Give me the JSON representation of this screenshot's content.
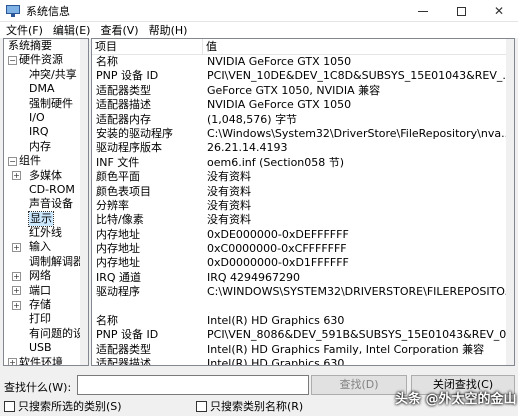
{
  "window": {
    "title": "系统信息"
  },
  "menu": {
    "file": "文件(F)",
    "edit": "编辑(E)",
    "view": "查看(V)",
    "help": "帮助(H)"
  },
  "tree": [
    {
      "label": "系统摘要",
      "indent": 0,
      "exp": ""
    },
    {
      "label": "硬件资源",
      "indent": 1,
      "exp": "−"
    },
    {
      "label": "冲突/共享",
      "indent": 2,
      "exp": ""
    },
    {
      "label": "DMA",
      "indent": 2,
      "exp": ""
    },
    {
      "label": "强制硬件",
      "indent": 2,
      "exp": ""
    },
    {
      "label": "I/O",
      "indent": 2,
      "exp": ""
    },
    {
      "label": "IRQ",
      "indent": 2,
      "exp": ""
    },
    {
      "label": "内存",
      "indent": 2,
      "exp": ""
    },
    {
      "label": "组件",
      "indent": 1,
      "exp": "−"
    },
    {
      "label": "多媒体",
      "indent": 2,
      "exp": "+"
    },
    {
      "label": "CD-ROM",
      "indent": 2,
      "exp": ""
    },
    {
      "label": "声音设备",
      "indent": 2,
      "exp": ""
    },
    {
      "label": "显示",
      "indent": 2,
      "exp": "",
      "selected": true
    },
    {
      "label": "红外线",
      "indent": 2,
      "exp": ""
    },
    {
      "label": "输入",
      "indent": 2,
      "exp": "+"
    },
    {
      "label": "调制解调器",
      "indent": 2,
      "exp": ""
    },
    {
      "label": "网络",
      "indent": 2,
      "exp": "+"
    },
    {
      "label": "端口",
      "indent": 2,
      "exp": "+"
    },
    {
      "label": "存储",
      "indent": 2,
      "exp": "+"
    },
    {
      "label": "打印",
      "indent": 2,
      "exp": ""
    },
    {
      "label": "有问题的设",
      "indent": 2,
      "exp": ""
    },
    {
      "label": "USB",
      "indent": 2,
      "exp": ""
    },
    {
      "label": "软件环境",
      "indent": 1,
      "exp": "+"
    }
  ],
  "table": {
    "col_item": "项目",
    "col_value": "值",
    "rows": [
      {
        "item": "名称",
        "value": "NVIDIA GeForce GTX 1050"
      },
      {
        "item": "PNP 设备 ID",
        "value": "PCI\\VEN_10DE&DEV_1C8D&SUBSYS_15E01043&REV_..."
      },
      {
        "item": "适配器类型",
        "value": "GeForce GTX 1050, NVIDIA 兼容"
      },
      {
        "item": "适配器描述",
        "value": "NVIDIA GeForce GTX 1050"
      },
      {
        "item": "适配器内存",
        "value": "(1,048,576) 字节"
      },
      {
        "item": "安装的驱动程序",
        "value": "C:\\Windows\\System32\\DriverStore\\FileRepository\\nva..."
      },
      {
        "item": "驱动程序版本",
        "value": "26.21.14.4193"
      },
      {
        "item": "INF 文件",
        "value": "oem6.inf (Section058 节)"
      },
      {
        "item": "颜色平面",
        "value": "没有资料"
      },
      {
        "item": "颜色表项目",
        "value": "没有资料"
      },
      {
        "item": "分辨率",
        "value": "没有资料"
      },
      {
        "item": "比特/像素",
        "value": "没有资料"
      },
      {
        "item": "内存地址",
        "value": "0xDE000000-0xDEFFFFFF"
      },
      {
        "item": "内存地址",
        "value": "0xC0000000-0xCFFFFFFF"
      },
      {
        "item": "内存地址",
        "value": "0xD0000000-0xD1FFFFFF"
      },
      {
        "item": "IRQ 通道",
        "value": "IRQ 4294967290"
      },
      {
        "item": "驱动程序",
        "value": "C:\\WINDOWS\\SYSTEM32\\DRIVERSTORE\\FILEREPOSITO..."
      },
      {
        "item": "",
        "value": ""
      },
      {
        "item": "名称",
        "value": "Intel(R) HD Graphics 630"
      },
      {
        "item": "PNP 设备 ID",
        "value": "PCI\\VEN_8086&DEV_591B&SUBSYS_15E01043&REV_0..."
      },
      {
        "item": "适配器类型",
        "value": "Intel(R) HD Graphics Family, Intel Corporation 兼容"
      },
      {
        "item": "适配器描述",
        "value": "Intel(R) HD Graphics 630"
      }
    ]
  },
  "find": {
    "label": "查找什么(W):",
    "input_value": "",
    "find_button": "查找(D)",
    "close_button": "关闭查找(C)",
    "only_selected": "只搜索所选的类别(S)",
    "only_names": "只搜索类别名称(R)"
  },
  "watermark": "头条 @外太空的金山"
}
